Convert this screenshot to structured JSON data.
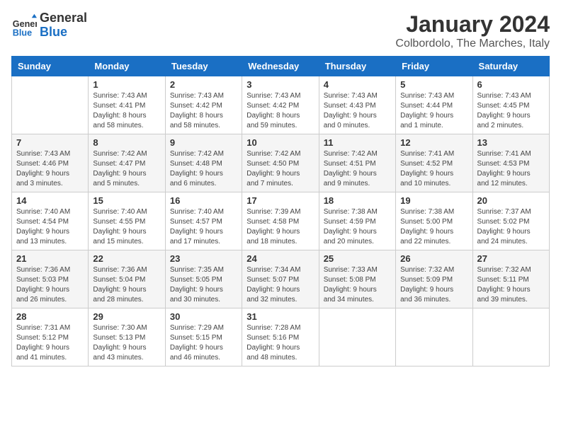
{
  "header": {
    "logo_line1": "General",
    "logo_line2": "Blue",
    "month": "January 2024",
    "location": "Colbordolo, The Marches, Italy"
  },
  "days_of_week": [
    "Sunday",
    "Monday",
    "Tuesday",
    "Wednesday",
    "Thursday",
    "Friday",
    "Saturday"
  ],
  "weeks": [
    [
      {
        "day": "",
        "info": ""
      },
      {
        "day": "1",
        "info": "Sunrise: 7:43 AM\nSunset: 4:41 PM\nDaylight: 8 hours\nand 58 minutes."
      },
      {
        "day": "2",
        "info": "Sunrise: 7:43 AM\nSunset: 4:42 PM\nDaylight: 8 hours\nand 58 minutes."
      },
      {
        "day": "3",
        "info": "Sunrise: 7:43 AM\nSunset: 4:42 PM\nDaylight: 8 hours\nand 59 minutes."
      },
      {
        "day": "4",
        "info": "Sunrise: 7:43 AM\nSunset: 4:43 PM\nDaylight: 9 hours\nand 0 minutes."
      },
      {
        "day": "5",
        "info": "Sunrise: 7:43 AM\nSunset: 4:44 PM\nDaylight: 9 hours\nand 1 minute."
      },
      {
        "day": "6",
        "info": "Sunrise: 7:43 AM\nSunset: 4:45 PM\nDaylight: 9 hours\nand 2 minutes."
      }
    ],
    [
      {
        "day": "7",
        "info": "Sunrise: 7:43 AM\nSunset: 4:46 PM\nDaylight: 9 hours\nand 3 minutes."
      },
      {
        "day": "8",
        "info": "Sunrise: 7:42 AM\nSunset: 4:47 PM\nDaylight: 9 hours\nand 5 minutes."
      },
      {
        "day": "9",
        "info": "Sunrise: 7:42 AM\nSunset: 4:48 PM\nDaylight: 9 hours\nand 6 minutes."
      },
      {
        "day": "10",
        "info": "Sunrise: 7:42 AM\nSunset: 4:50 PM\nDaylight: 9 hours\nand 7 minutes."
      },
      {
        "day": "11",
        "info": "Sunrise: 7:42 AM\nSunset: 4:51 PM\nDaylight: 9 hours\nand 9 minutes."
      },
      {
        "day": "12",
        "info": "Sunrise: 7:41 AM\nSunset: 4:52 PM\nDaylight: 9 hours\nand 10 minutes."
      },
      {
        "day": "13",
        "info": "Sunrise: 7:41 AM\nSunset: 4:53 PM\nDaylight: 9 hours\nand 12 minutes."
      }
    ],
    [
      {
        "day": "14",
        "info": "Sunrise: 7:40 AM\nSunset: 4:54 PM\nDaylight: 9 hours\nand 13 minutes."
      },
      {
        "day": "15",
        "info": "Sunrise: 7:40 AM\nSunset: 4:55 PM\nDaylight: 9 hours\nand 15 minutes."
      },
      {
        "day": "16",
        "info": "Sunrise: 7:40 AM\nSunset: 4:57 PM\nDaylight: 9 hours\nand 17 minutes."
      },
      {
        "day": "17",
        "info": "Sunrise: 7:39 AM\nSunset: 4:58 PM\nDaylight: 9 hours\nand 18 minutes."
      },
      {
        "day": "18",
        "info": "Sunrise: 7:38 AM\nSunset: 4:59 PM\nDaylight: 9 hours\nand 20 minutes."
      },
      {
        "day": "19",
        "info": "Sunrise: 7:38 AM\nSunset: 5:00 PM\nDaylight: 9 hours\nand 22 minutes."
      },
      {
        "day": "20",
        "info": "Sunrise: 7:37 AM\nSunset: 5:02 PM\nDaylight: 9 hours\nand 24 minutes."
      }
    ],
    [
      {
        "day": "21",
        "info": "Sunrise: 7:36 AM\nSunset: 5:03 PM\nDaylight: 9 hours\nand 26 minutes."
      },
      {
        "day": "22",
        "info": "Sunrise: 7:36 AM\nSunset: 5:04 PM\nDaylight: 9 hours\nand 28 minutes."
      },
      {
        "day": "23",
        "info": "Sunrise: 7:35 AM\nSunset: 5:05 PM\nDaylight: 9 hours\nand 30 minutes."
      },
      {
        "day": "24",
        "info": "Sunrise: 7:34 AM\nSunset: 5:07 PM\nDaylight: 9 hours\nand 32 minutes."
      },
      {
        "day": "25",
        "info": "Sunrise: 7:33 AM\nSunset: 5:08 PM\nDaylight: 9 hours\nand 34 minutes."
      },
      {
        "day": "26",
        "info": "Sunrise: 7:32 AM\nSunset: 5:09 PM\nDaylight: 9 hours\nand 36 minutes."
      },
      {
        "day": "27",
        "info": "Sunrise: 7:32 AM\nSunset: 5:11 PM\nDaylight: 9 hours\nand 39 minutes."
      }
    ],
    [
      {
        "day": "28",
        "info": "Sunrise: 7:31 AM\nSunset: 5:12 PM\nDaylight: 9 hours\nand 41 minutes."
      },
      {
        "day": "29",
        "info": "Sunrise: 7:30 AM\nSunset: 5:13 PM\nDaylight: 9 hours\nand 43 minutes."
      },
      {
        "day": "30",
        "info": "Sunrise: 7:29 AM\nSunset: 5:15 PM\nDaylight: 9 hours\nand 46 minutes."
      },
      {
        "day": "31",
        "info": "Sunrise: 7:28 AM\nSunset: 5:16 PM\nDaylight: 9 hours\nand 48 minutes."
      },
      {
        "day": "",
        "info": ""
      },
      {
        "day": "",
        "info": ""
      },
      {
        "day": "",
        "info": ""
      }
    ]
  ]
}
